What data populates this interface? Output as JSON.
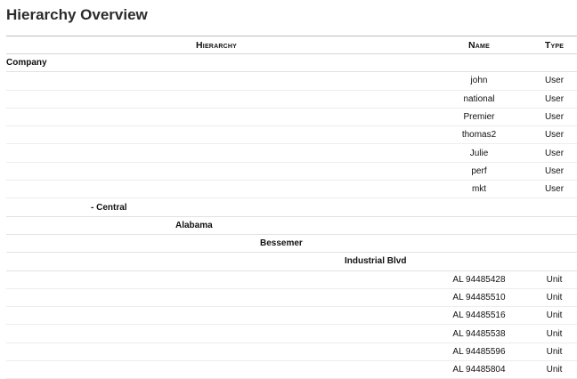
{
  "page": {
    "title": "Hierarchy Overview"
  },
  "table": {
    "headers": {
      "hierarchy": "Hierarchy",
      "name": "Name",
      "type": "Type"
    },
    "rows": [
      {
        "kind": "group",
        "level": 0,
        "label": "Company"
      },
      {
        "kind": "item",
        "name": "john",
        "type": "User"
      },
      {
        "kind": "item",
        "name": "national",
        "type": "User"
      },
      {
        "kind": "item",
        "name": "Premier",
        "type": "User"
      },
      {
        "kind": "item",
        "name": "thomas2",
        "type": "User"
      },
      {
        "kind": "item",
        "name": "Julie",
        "type": "User"
      },
      {
        "kind": "item",
        "name": "perf",
        "type": "User"
      },
      {
        "kind": "item",
        "name": "mkt",
        "type": "User"
      },
      {
        "kind": "group",
        "level": 1,
        "label": "- Central"
      },
      {
        "kind": "group",
        "level": 2,
        "label": "Alabama"
      },
      {
        "kind": "group",
        "level": 3,
        "label": "Bessemer"
      },
      {
        "kind": "group",
        "level": 4,
        "label": "Industrial Blvd"
      },
      {
        "kind": "item",
        "name": "AL 94485428",
        "type": "Unit"
      },
      {
        "kind": "item",
        "name": "AL 94485510",
        "type": "Unit"
      },
      {
        "kind": "item",
        "name": "AL 94485516",
        "type": "Unit"
      },
      {
        "kind": "item",
        "name": "AL 94485538",
        "type": "Unit"
      },
      {
        "kind": "item",
        "name": "AL 94485596",
        "type": "Unit"
      },
      {
        "kind": "item",
        "name": "AL 94485804",
        "type": "Unit"
      }
    ]
  }
}
